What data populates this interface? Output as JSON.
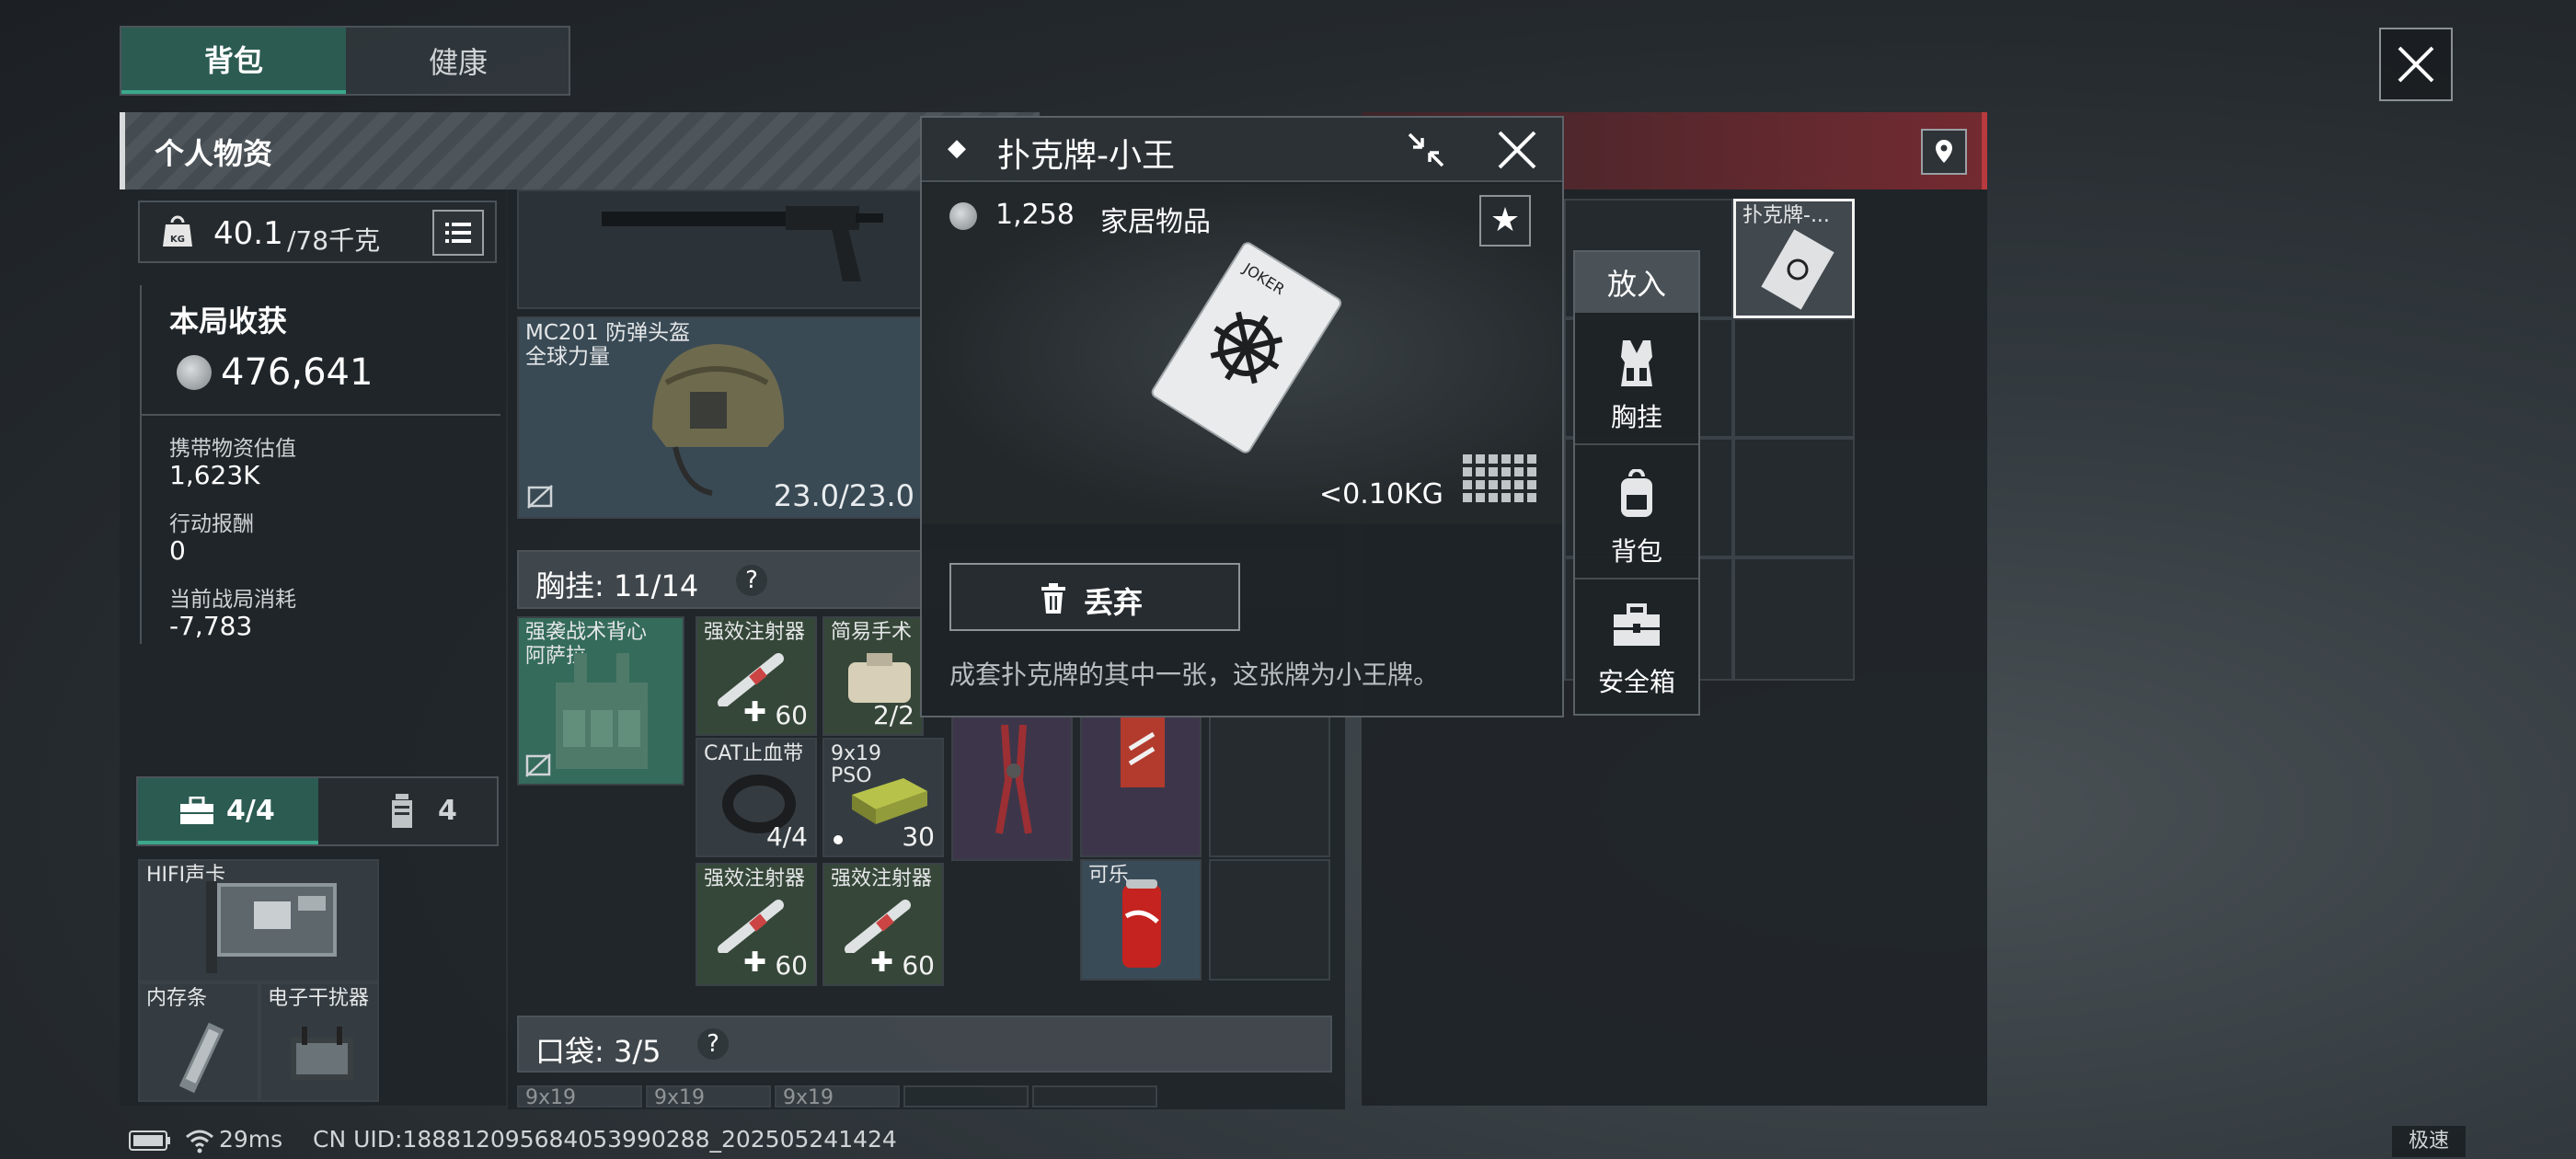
{
  "tabs": [
    {
      "label": "背包",
      "active": true
    },
    {
      "label": "健康",
      "active": false
    }
  ],
  "personal": {
    "title": "个人物资",
    "weight_value": "40.1",
    "weight_max": "/78千克",
    "weight_icon_text": "KG",
    "harvest_title": "本局收获",
    "harvest_value": "476,641",
    "stats": [
      {
        "label": "携带物资估值",
        "value": "1,623K"
      },
      {
        "label": "行动报酬",
        "value": "0"
      },
      {
        "label": "当前战局消耗",
        "value": "-7,783"
      }
    ],
    "secure_tabs": [
      {
        "label": "4/4",
        "icon": "briefcase-icon"
      },
      {
        "label": "4",
        "icon": "canister-icon"
      }
    ],
    "secure_items": [
      {
        "label": "HIFI声卡"
      },
      {
        "label": "内存条"
      },
      {
        "label": "电子干扰器"
      }
    ]
  },
  "gear": {
    "helmet_name": "MC201 防弹头盔",
    "helmet_sub": "全球力量",
    "helmet_durability": "23.0/23.0",
    "chest_header": "胸挂: 11/14",
    "pocket_header": "口袋: 3/5",
    "help": "?",
    "chest_items": [
      {
        "label": "强袭战术背心",
        "sub": "阿萨拉"
      },
      {
        "label": "强效注射器",
        "count": "60"
      },
      {
        "label": "简易手术",
        "count": "2/2"
      },
      {
        "label": "CAT止血带",
        "count": "4/4"
      },
      {
        "label": "9x19",
        "sub": "PSO",
        "count": "30"
      },
      {
        "label": "强效注射器",
        "count": "60"
      },
      {
        "label": "强效注射器",
        "count": "60"
      },
      {
        "label": "可乐"
      }
    ],
    "pocket_items": [
      "9x19",
      "9x19",
      "9x19"
    ]
  },
  "popup": {
    "title": "扑克牌-小王",
    "price": "1,258",
    "category": "家居物品",
    "weight": "<0.10KG",
    "discard_label": "丢弃",
    "description": "成套扑克牌的其中一张，这张牌为小王牌。",
    "card_text": "JOKER"
  },
  "put_menu": {
    "title": "放入",
    "options": [
      {
        "label": "胸挂",
        "icon": "vest-icon"
      },
      {
        "label": "背包",
        "icon": "backpack-icon"
      },
      {
        "label": "安全箱",
        "icon": "safebox-icon"
      }
    ]
  },
  "loot": {
    "card_label": "扑克牌-..."
  },
  "status": {
    "ping": "29ms",
    "uid": "CN UID:18881209568405399028​8_202505241424",
    "speed": "极速"
  },
  "colors": {
    "accent_green": "#3ba88b",
    "danger_red": "#b83a3f",
    "tab_active": "#2c5b52"
  }
}
